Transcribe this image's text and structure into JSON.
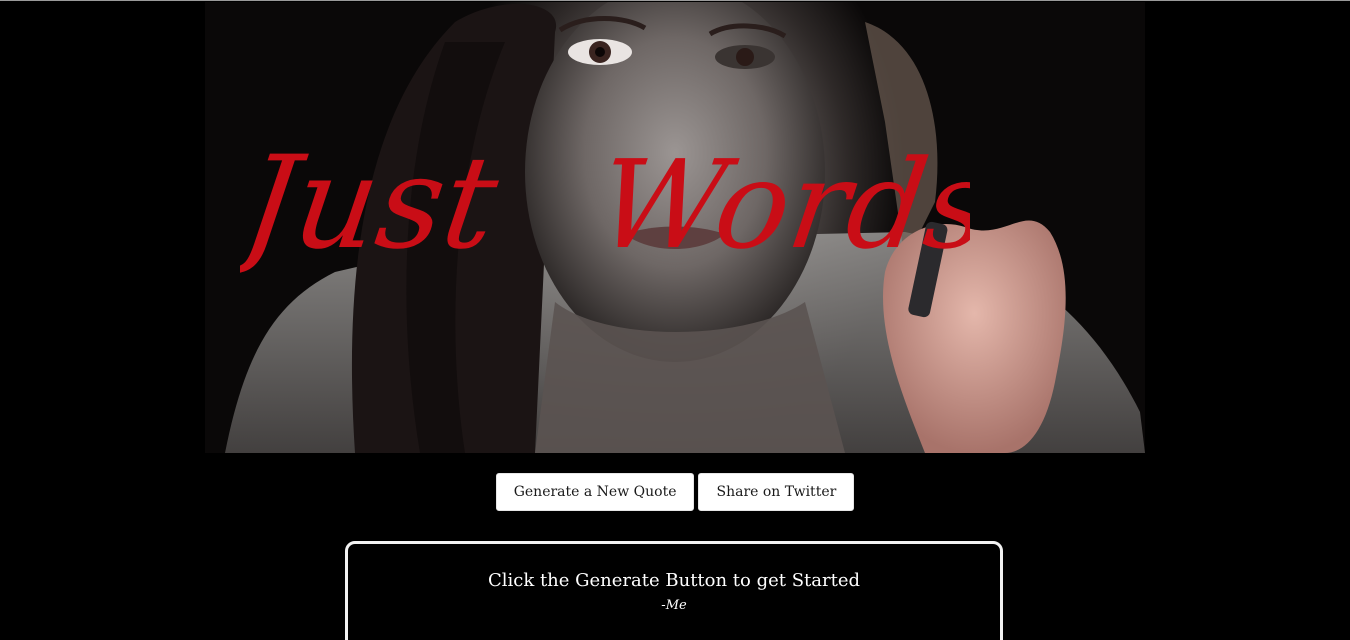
{
  "hero": {
    "title_word_1": "Just",
    "title_word_2": "Words",
    "title_color": "#c90d16"
  },
  "buttons": {
    "generate_label": "Generate a New Quote",
    "twitter_label": "Share on Twitter"
  },
  "quote": {
    "text": "Click the Generate Button to get Started",
    "author": "-Me"
  },
  "colors": {
    "page_background": "#000000",
    "button_background": "#ffffff",
    "quote_border": "#f3f3f3",
    "quote_text": "#ffffff"
  }
}
